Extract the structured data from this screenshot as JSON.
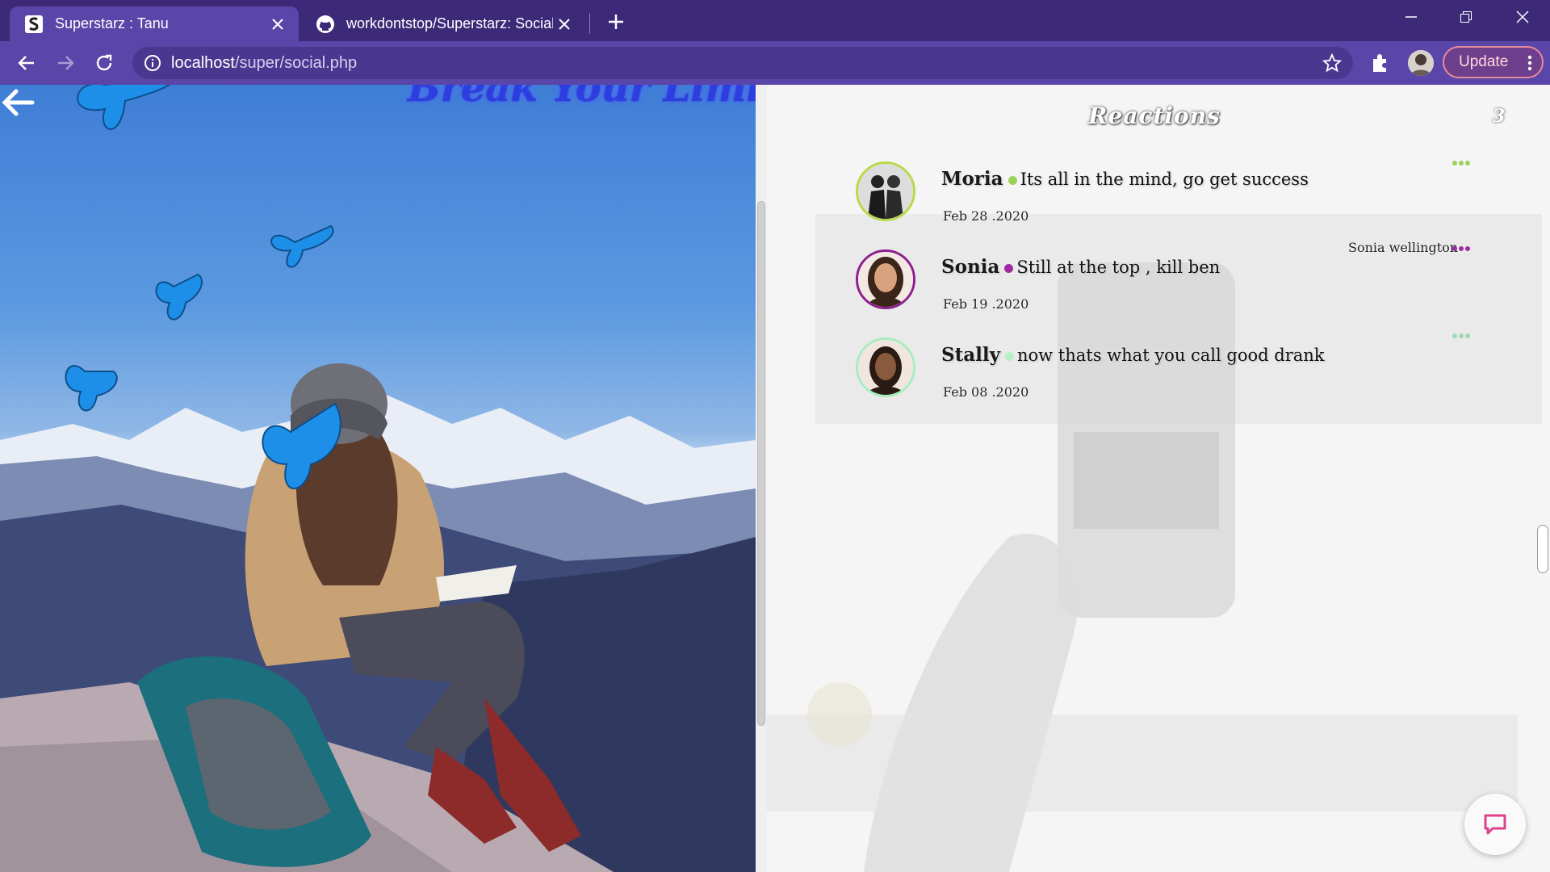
{
  "browser": {
    "tabs": [
      {
        "title": "Superstarz : Tanu",
        "active": true,
        "icon": "superstarz-favicon"
      },
      {
        "title": "workdontstop/Superstarz: Social",
        "active": false,
        "icon": "github-icon"
      }
    ],
    "url_host": "localhost",
    "url_path": "/super/social.php",
    "update_label": "Update",
    "theme_color": "#5a45a8",
    "tabstrip_color": "#3c2a78"
  },
  "page": {
    "slogan": "Break Your Limits",
    "reactions_title": "Reactions",
    "reactions_count": "3",
    "comments": [
      {
        "name": "Moria",
        "text": "Its all in the mind, go get success",
        "date": "Feb 28 .2020",
        "status_color": "#9bd35a",
        "ring_color": "#b7d94a"
      },
      {
        "name": "Sonia",
        "text": "Still at the top , kill ben",
        "date": "Feb 19 .2020",
        "status_color": "#a02ba0",
        "ring_color": "#8e1f8e"
      },
      {
        "name": "Stally",
        "text": "now thats what you call good drank",
        "date": "Feb 08 .2020",
        "status_color": "#b6f0c8",
        "ring_color": "#a8ecc0"
      }
    ],
    "author_tag": "Sonia wellington",
    "more_colors": [
      "#9bd35a",
      "#a02ba0",
      "#9cd8b4"
    ]
  }
}
